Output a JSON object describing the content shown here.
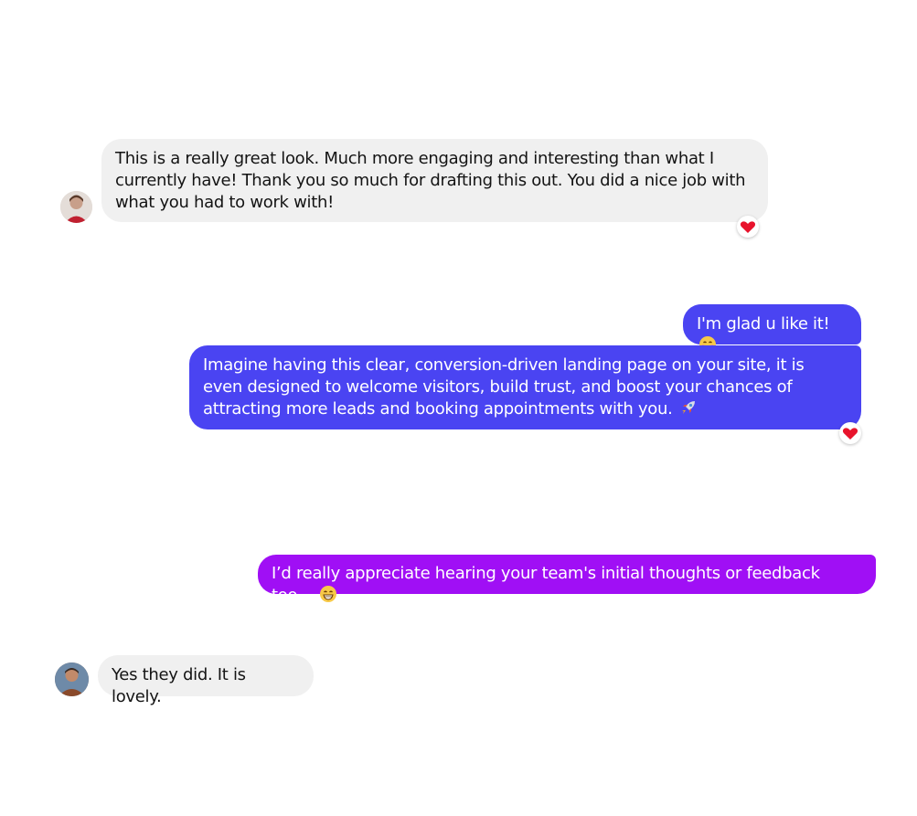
{
  "colors": {
    "incoming_bubble": "#f0f0f0",
    "outgoing_blue": "#4a44f2",
    "outgoing_purple": "#a00ff5",
    "reaction_heart": "#e8132c"
  },
  "messages": [
    {
      "sender": "other",
      "text": "This is a really great look. Much more engaging and interesting than what I currently have! Thank you so much for drafting this out. You did a nice job with what you had to work with!",
      "reaction": "heart-icon"
    },
    {
      "sender": "me",
      "text": "I'm glad u like it!",
      "emoji": "smiling-face-icon"
    },
    {
      "sender": "me",
      "text": "Imagine having this clear, conversion-driven landing page on your site, it is even designed to welcome visitors, build trust, and boost your chances of attracting more leads and booking appointments with you.",
      "emoji": "rocket-icon",
      "reaction": "heart-icon"
    },
    {
      "sender": "me",
      "text": "I’d really appreciate hearing your team's initial thoughts or feedback too...",
      "emoji": "grinning-face-icon"
    },
    {
      "sender": "other",
      "text": "Yes they did. It is lovely."
    }
  ]
}
